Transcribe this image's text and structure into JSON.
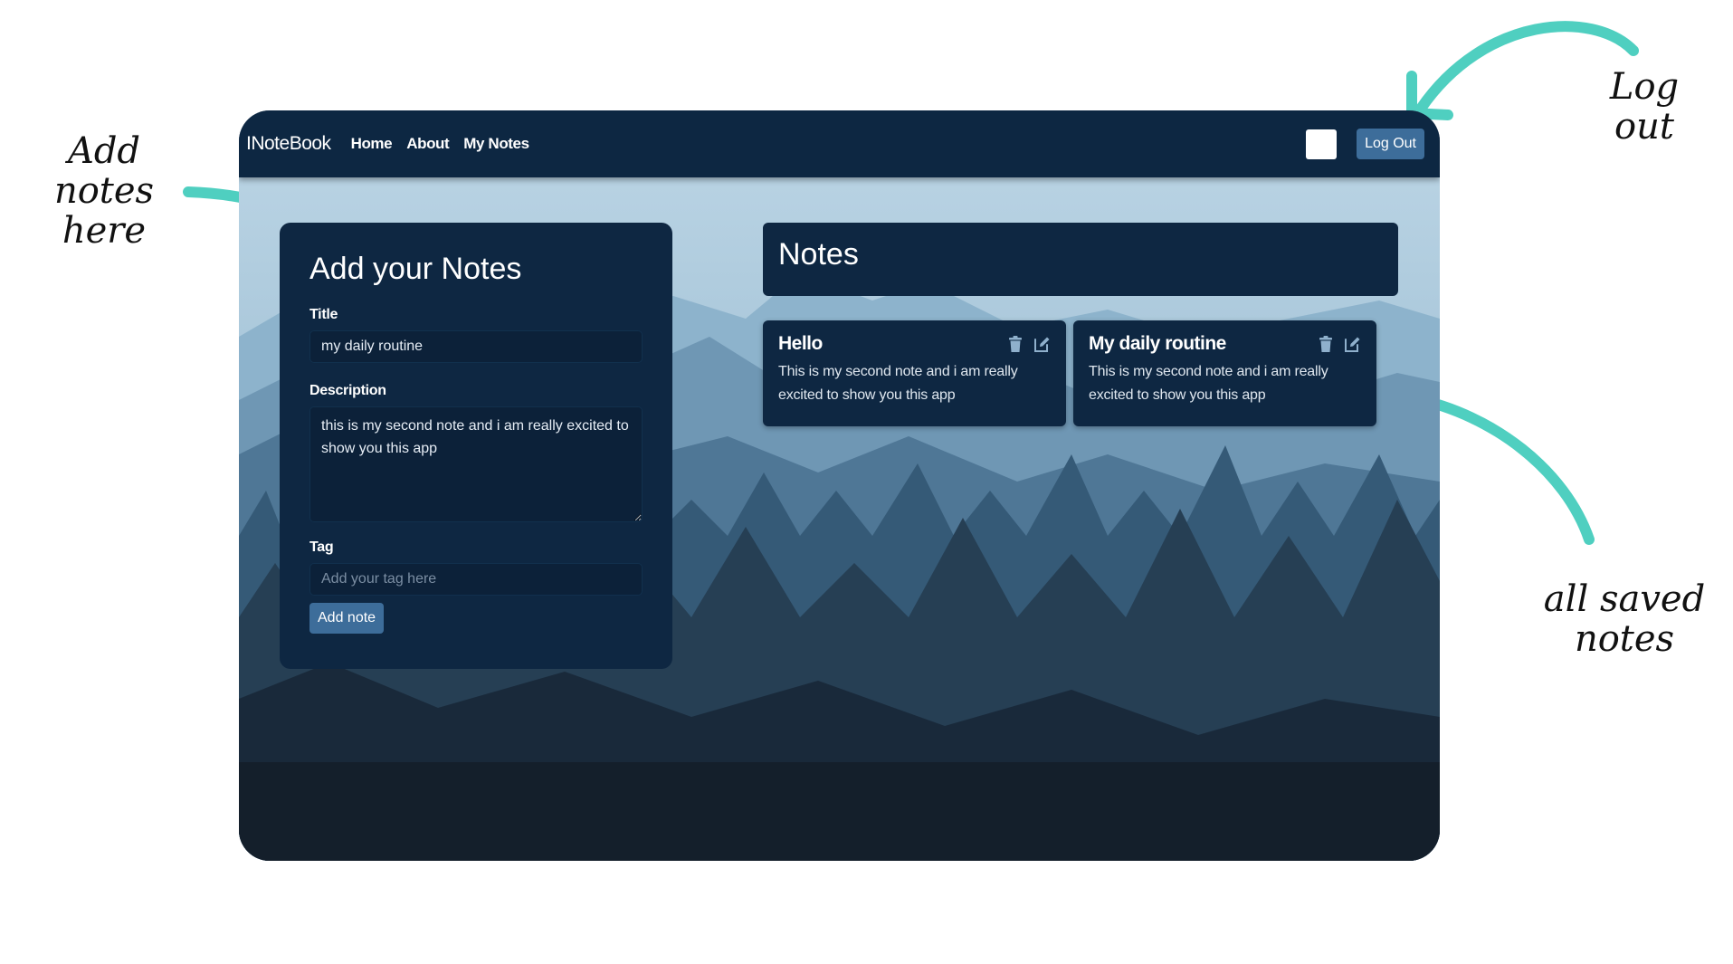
{
  "annotations": {
    "add_notes": "Add notes here",
    "log_out": "Log out",
    "all_saved_notes": "all saved notes",
    "arrow_color": "#4fcfc0"
  },
  "navbar": {
    "brand": "INoteBook",
    "links": [
      "Home",
      "About",
      "My Notes"
    ],
    "logout_label": "Log Out"
  },
  "add_form": {
    "heading": "Add your Notes",
    "title_label": "Title",
    "title_value": "my daily routine",
    "description_label": "Description",
    "description_value": "this is my second note and i am really excited to show you this app",
    "tag_label": "Tag",
    "tag_placeholder": "Add your tag here",
    "tag_value": "",
    "submit_label": "Add note"
  },
  "notes": {
    "heading": "Notes",
    "items": [
      {
        "title": "Hello",
        "description": "This is my second note and i am really excited to show you this app",
        "delete_icon": "trash-icon",
        "edit_icon": "edit-icon"
      },
      {
        "title": "My daily routine",
        "description": "This is my second note and i am really excited to show you this app",
        "delete_icon": "trash-icon",
        "edit_icon": "edit-icon"
      }
    ]
  },
  "colors": {
    "navbar": "#0d2742",
    "panel": "#0e2742",
    "button": "#3d6d9a",
    "sky": "#b9d3e3"
  }
}
